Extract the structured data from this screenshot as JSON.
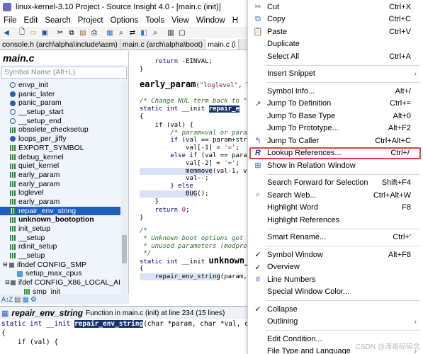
{
  "window": {
    "title": "linux-kernel-3.10 Project - Source Insight 4.0 - [main.c (init)]"
  },
  "menubar": [
    "File",
    "Edit",
    "Search",
    "Project",
    "Options",
    "Tools",
    "View",
    "Window",
    "H"
  ],
  "tabs": [
    {
      "label": "console.h (arch\\alpha\\include\\asm)"
    },
    {
      "label": "main.c (arch\\alpha\\boot)"
    },
    {
      "label": "main.c (i"
    }
  ],
  "symbol_panel": {
    "title": "main.c",
    "search_placeholder": "Symbol Name (Alt+L)",
    "items": [
      {
        "label": "envp_init",
        "icon": "blank",
        "indent": 1
      },
      {
        "label": "panic_later",
        "icon": "fn",
        "indent": 1
      },
      {
        "label": "panic_param",
        "icon": "fn",
        "indent": 1
      },
      {
        "label": "__setup_start",
        "icon": "blank",
        "indent": 1
      },
      {
        "label": "__setup_end",
        "icon": "blank",
        "indent": 1
      },
      {
        "label": "obsolete_checksetup",
        "icon": "grid",
        "indent": 1
      },
      {
        "label": "loops_per_jiffy",
        "icon": "fn",
        "indent": 1
      },
      {
        "label": "EXPORT_SYMBOL",
        "icon": "grid",
        "indent": 1
      },
      {
        "label": "debug_kernel",
        "icon": "grid",
        "indent": 1
      },
      {
        "label": "quiet_kernel",
        "icon": "grid",
        "indent": 1
      },
      {
        "label": "early_param",
        "icon": "grid",
        "indent": 1
      },
      {
        "label": "early_param",
        "icon": "grid",
        "indent": 1
      },
      {
        "label": "loglevel",
        "icon": "grid",
        "indent": 1
      },
      {
        "label": "early_param",
        "icon": "grid",
        "indent": 1
      },
      {
        "label": "repair_env_string",
        "icon": "grid",
        "indent": 1,
        "selected": true
      },
      {
        "label": "unknown_bootoption",
        "icon": "grid",
        "indent": 1,
        "bold": true
      },
      {
        "label": "init_setup",
        "icon": "grid",
        "indent": 1
      },
      {
        "label": "__setup",
        "icon": "grid",
        "indent": 1
      },
      {
        "label": "rdinit_setup",
        "icon": "grid",
        "indent": 1
      },
      {
        "label": "__setup",
        "icon": "grid",
        "indent": 1
      },
      {
        "label": "ifndef CONFIG_SMP",
        "icon": "ifd",
        "indent": 0,
        "toggle": "⊟"
      },
      {
        "label": "setup_max_cpus",
        "icon": "var",
        "indent": 2
      },
      {
        "label": "ifdef CONFIG_X86_LOCAL_AI",
        "icon": "ifd",
        "indent": 1,
        "toggle": "⊟"
      },
      {
        "label": "smp_init",
        "icon": "grid",
        "indent": 3
      }
    ],
    "footer_icons": [
      "A↕Z",
      "sort-icon",
      "filter-icon",
      "settings-icon"
    ]
  },
  "editor": {
    "lines": [
      {
        "parts": [
          [
            "kw",
            "    return "
          ],
          [
            "",
            "-EINVAL;"
          ]
        ]
      },
      {
        "parts": [
          [
            "",
            "}"
          ]
        ]
      },
      {
        "parts": []
      },
      {
        "parts": [
          [
            "big",
            "early_param"
          ],
          [
            "",
            "("
          ],
          [
            "str",
            "\"loglevel\""
          ],
          [
            "",
            ", lo"
          ]
        ]
      },
      {
        "parts": []
      },
      {
        "parts": [
          [
            "cmt",
            "/* Change NUL term back to \"="
          ]
        ]
      },
      {
        "parts": [
          [
            "kw",
            "static int "
          ],
          [
            "",
            "__init "
          ],
          [
            "hl",
            "repair_e"
          ]
        ]
      },
      {
        "parts": [
          [
            "",
            "{"
          ]
        ]
      },
      {
        "parts": [
          [
            "kw",
            "    if "
          ],
          [
            "",
            "(val) {"
          ]
        ]
      },
      {
        "parts": [
          [
            "cmt",
            "        /* param=val or param"
          ]
        ]
      },
      {
        "parts": [
          [
            "kw",
            "        if "
          ],
          [
            "",
            "(val == param+strl"
          ]
        ]
      },
      {
        "parts": [
          [
            "",
            "            val[-1] = "
          ],
          [
            "str",
            "'='"
          ],
          [
            "",
            ";"
          ]
        ]
      },
      {
        "parts": [
          [
            "kw",
            "        else if "
          ],
          [
            "",
            "(val == param"
          ]
        ]
      },
      {
        "parts": [
          [
            "",
            "            val[-2] = "
          ],
          [
            "str",
            "'='"
          ],
          [
            "",
            ";"
          ]
        ]
      },
      {
        "parts": [
          [
            "hlfn",
            "            memmove"
          ],
          [
            "",
            "(val-1, va"
          ]
        ]
      },
      {
        "parts": [
          [
            "",
            "            val--;"
          ]
        ]
      },
      {
        "parts": [
          [
            "kw",
            "        } else"
          ]
        ]
      },
      {
        "parts": [
          [
            "hlfn",
            "            BUG"
          ],
          [
            "",
            "();"
          ]
        ]
      },
      {
        "parts": [
          [
            "",
            "    }"
          ]
        ]
      },
      {
        "parts": [
          [
            "kw",
            "    return "
          ],
          [
            "num",
            "0"
          ],
          [
            "",
            ";"
          ]
        ]
      },
      {
        "parts": [
          [
            "",
            "}"
          ]
        ]
      },
      {
        "parts": []
      },
      {
        "parts": [
          [
            "cmt",
            "/*"
          ]
        ]
      },
      {
        "parts": [
          [
            "cmt",
            " * Unknown boot options get h"
          ]
        ]
      },
      {
        "parts": [
          [
            "cmt",
            " * unused parameters (modprob"
          ]
        ]
      },
      {
        "parts": [
          [
            "cmt",
            " */"
          ]
        ]
      },
      {
        "parts": [
          [
            "kw",
            "static int "
          ],
          [
            "",
            "__init "
          ],
          [
            "bigb",
            "unknown_"
          ]
        ]
      },
      {
        "parts": [
          [
            "",
            "{"
          ]
        ]
      },
      {
        "parts": [
          [
            "hlfn",
            "    repair_env_string"
          ],
          [
            "",
            "(param,"
          ]
        ]
      },
      {
        "parts": []
      },
      {
        "parts": []
      }
    ]
  },
  "context_window": {
    "symbol": "repair_env_string",
    "description": "Function in main.c (init) at line 234 (15 lines)",
    "code_line1": [
      "static int __init ",
      "repair_env_string",
      "(char *param, char *val, c"
    ],
    "code_line3": "    if (val) {"
  },
  "context_menu": {
    "items": [
      {
        "label": "Cut",
        "shortcut": "Ctrl+X",
        "icon": "scissors-icon",
        "glyph": "✂"
      },
      {
        "label": "Copy",
        "shortcut": "Ctrl+C",
        "icon": "copy-icon",
        "glyph": "⧉"
      },
      {
        "label": "Paste",
        "shortcut": "Ctrl+V",
        "icon": "paste-icon",
        "glyph": "📋"
      },
      {
        "label": "Duplicate",
        "shortcut": ""
      },
      {
        "label": "Select All",
        "shortcut": "Ctrl+A"
      },
      {
        "sep": true
      },
      {
        "label": "Insert Snippet",
        "shortcut": "",
        "submenu": true
      },
      {
        "sep": true
      },
      {
        "label": "Symbol Info...",
        "shortcut": "Alt+/"
      },
      {
        "label": "Jump To Definition",
        "shortcut": "Ctrl+=",
        "icon": "jump-definition-icon",
        "glyph": "↗"
      },
      {
        "label": "Jump To Base Type",
        "shortcut": "Alt+0"
      },
      {
        "label": "Jump To Prototype...",
        "shortcut": "Alt+F2"
      },
      {
        "label": "Jump To Caller",
        "shortcut": "Ctrl+Alt+C",
        "icon": "jump-caller-icon",
        "glyph": "↰"
      },
      {
        "label": "Lookup References...",
        "shortcut": "Ctrl+/",
        "icon": "lookup-references-icon",
        "glyph": "R",
        "highlighted": true
      },
      {
        "label": "Show in Relation Window",
        "shortcut": "",
        "icon": "relation-window-icon",
        "glyph": "⊞"
      },
      {
        "sep": true
      },
      {
        "label": "Search Forward for Selection",
        "shortcut": "Shift+F4"
      },
      {
        "label": "Search Web...",
        "shortcut": "Ctrl+Alt+W",
        "icon": "search-web-icon",
        "glyph": "⌕"
      },
      {
        "label": "Highlight Word",
        "shortcut": "F8"
      },
      {
        "label": "Highlight References",
        "shortcut": ""
      },
      {
        "sep": true
      },
      {
        "label": "Smart Rename...",
        "shortcut": "Ctrl+'"
      },
      {
        "sep": true
      },
      {
        "label": "Symbol Window",
        "shortcut": "Alt+F8",
        "check": true
      },
      {
        "label": "Overview",
        "shortcut": "",
        "check": true
      },
      {
        "label": "Line Numbers",
        "shortcut": "",
        "icon": "line-numbers-icon",
        "glyph": "#"
      },
      {
        "label": "Special Window Color...",
        "shortcut": ""
      },
      {
        "sep": true
      },
      {
        "label": "Collapse",
        "shortcut": "",
        "check": true
      },
      {
        "label": "Outlining",
        "shortcut": "",
        "submenu": true
      },
      {
        "sep": true
      },
      {
        "label": "Edit Condition...",
        "shortcut": ""
      },
      {
        "label": "File Type and Language",
        "shortcut": "",
        "submenu": true
      },
      {
        "label": "Style Properties",
        "shortcut": ""
      }
    ]
  },
  "watermark": "CSDN @涛哥碎碎念"
}
